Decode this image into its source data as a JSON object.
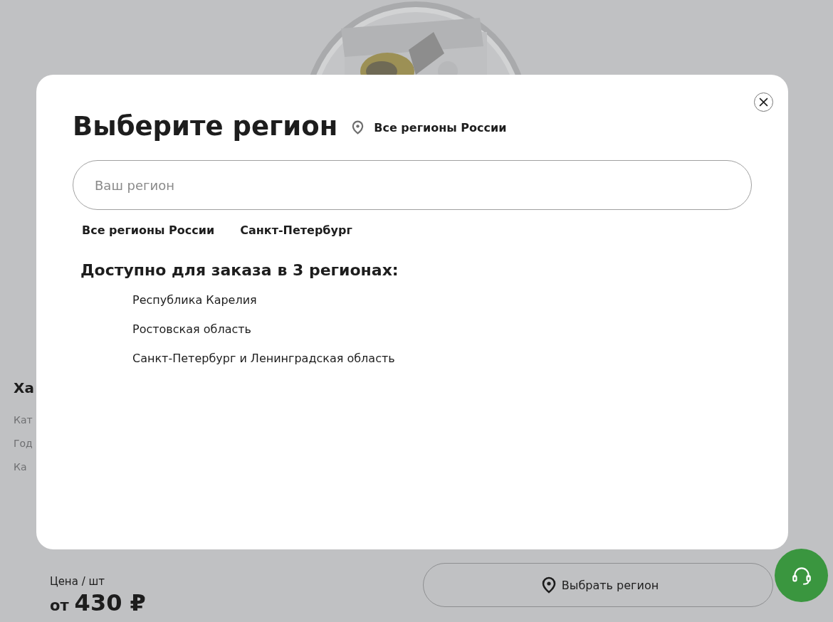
{
  "page": {
    "characteristics": {
      "title": "Ха",
      "rows": [
        "Кат",
        "Год",
        "Ка"
      ]
    },
    "price": {
      "label": "Цена / шт",
      "prefix": "от",
      "value": "430 ₽"
    },
    "region_button": {
      "label": "Выбрать регион"
    }
  },
  "modal": {
    "title": "Выберите регион",
    "current_region": "Все регионы России",
    "search": {
      "placeholder": "Ваш регион"
    },
    "quick_links": [
      "Все регионы России",
      "Санкт-Петербург"
    ],
    "available_heading": "Доступно для заказа в 3 регионах:",
    "regions": [
      "Республика Карелия",
      "Ростовская область",
      "Санкт-Петербург и Ленинградская область"
    ]
  }
}
